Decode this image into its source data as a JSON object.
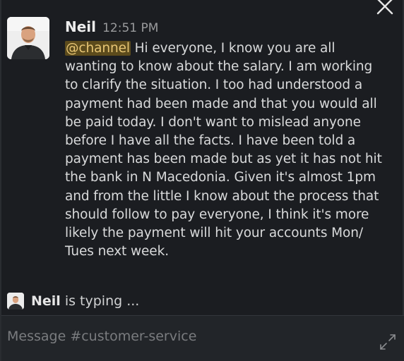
{
  "window": {
    "close_icon": "close-icon"
  },
  "message": {
    "sender": "Neil",
    "time": "12:51 PM",
    "mention": "@channel",
    "lines": [
      " Hi everyone, I know you are all",
      "wanting to know about the salary.  I am working",
      "to clarify the situation.  I too had understood a",
      "payment had been made and that you would all",
      "be paid today.  I don't want to mislead anyone",
      "before I have all the facts.  I have been told a",
      "payment has been made but as yet it has not hit",
      "the bank in N Macedonia. Given it's almost 1pm",
      "and from the little I know about the process that",
      "should follow to pay everyone, I think it's more",
      "likely the payment will hit your accounts Mon/",
      "Tues next week."
    ]
  },
  "typing_indicator": {
    "name": "Neil",
    "text": "is typing ..."
  },
  "composer": {
    "placeholder": "Message #customer-service",
    "expand_icon": "expand-icon"
  },
  "colors": {
    "background": "#1b1d21",
    "mention_bg": "#5c4b1c",
    "mention_text": "#e8c675",
    "text": "#d9dadb"
  }
}
